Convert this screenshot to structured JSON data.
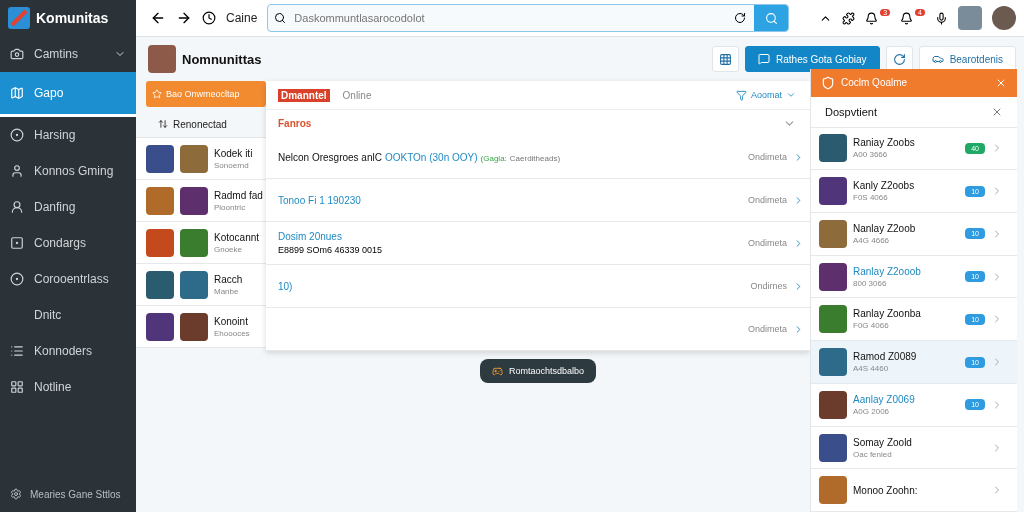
{
  "brand": {
    "name": "Komunitas"
  },
  "sidebar": {
    "items": [
      {
        "label": "Camtins",
        "expanded": false,
        "selected": false
      },
      {
        "label": "Gapo",
        "selected": true
      },
      {
        "label": "Harsing",
        "selected": false
      },
      {
        "label": "Konnos Gming",
        "selected": false
      },
      {
        "label": "Danfing",
        "selected": false
      },
      {
        "label": "Condargs",
        "selected": false
      },
      {
        "label": "Corooentrlass",
        "selected": false
      },
      {
        "label": "Dnitc",
        "selected": false
      },
      {
        "label": "Konnoders",
        "selected": false
      },
      {
        "label": "Notline",
        "selected": false
      }
    ],
    "footer": "Mearies Gane Sttlos"
  },
  "topbar": {
    "title": "Caine",
    "search": {
      "placeholder": "Daskommuntlasarocodolot"
    },
    "badges": [
      "3",
      "4"
    ]
  },
  "header": {
    "title": "Nomnunittas",
    "primary_button": "Rathes Gota Gobiay",
    "secondary_button": "Bearotdenis"
  },
  "list": {
    "action": "Bao Onwmeocltap",
    "sort": "Renonectad",
    "rows": [
      {
        "title": "Kodek iti",
        "subtitle": "Sonoernd"
      },
      {
        "title": "Radmd fad",
        "subtitle": "Ploontric"
      },
      {
        "title": "Kotocannt",
        "subtitle": "Gnoeke"
      },
      {
        "title": "Racch",
        "subtitle": "Manbe"
      },
      {
        "title": "Konoint",
        "subtitle": "Ehoooces"
      }
    ]
  },
  "dropdown": {
    "tabs": [
      {
        "label": "Dmanntel",
        "selected": true
      },
      {
        "label": "Online",
        "selected": false
      }
    ],
    "filter": "Aoomat",
    "section": "Fanros",
    "rows": [
      {
        "parts": [
          {
            "text": "Nelcon Oresgroes anlC",
            "kind": "plain"
          },
          {
            "text": "OOKTOn (30n OOY)",
            "kind": "link"
          },
          {
            "text": "(Gagla:",
            "kind": "tag"
          },
          {
            "text": "Caerditheads)",
            "kind": "note"
          }
        ],
        "detail": "",
        "status": "Ondimeta"
      },
      {
        "parts": [
          {
            "text": "Tonoo Fi 1 190230",
            "kind": "link"
          }
        ],
        "detail": "",
        "status": "Ondimeta"
      },
      {
        "parts": [
          {
            "text": "Dosim 20nues",
            "kind": "link"
          }
        ],
        "detail": "E8899 SOm6 46339 0015",
        "status": "Ondimeta"
      },
      {
        "parts": [
          {
            "text": "10)",
            "kind": "link"
          }
        ],
        "detail": "",
        "status": "Ondirnes"
      },
      {
        "parts": [],
        "detail": "",
        "status": "Ondimeta"
      }
    ]
  },
  "toast": "Romtaochtsdbalbo",
  "panel": {
    "title": "Coclm Qoalme",
    "subtitle": "Dospvtient",
    "items": [
      {
        "name": "Raniay Zoobs",
        "meta": "A00 3666",
        "badge": "40",
        "color": "#1fa866",
        "highlighted": false,
        "selected": false
      },
      {
        "name": "Kanly Z2oobs",
        "meta": "F0S 4066",
        "badge": "10",
        "color": "#2f9be0",
        "highlighted": false,
        "selected": false
      },
      {
        "name": "Nanlay Z2oob",
        "meta": "A4G 4666",
        "badge": "10",
        "color": "#2f9be0",
        "highlighted": false,
        "selected": false
      },
      {
        "name": "Ranlay Z2ooob",
        "meta": "800 3066",
        "badge": "10",
        "color": "#2f9be0",
        "highlighted": true,
        "selected": false
      },
      {
        "name": "Ranlay Zoonba",
        "meta": "F0G 4066",
        "badge": "10",
        "color": "#2f9be0",
        "highlighted": false,
        "selected": false
      },
      {
        "name": "Ramod Z0089",
        "meta": "A4S 4460",
        "badge": "10",
        "color": "#2f9be0",
        "highlighted": false,
        "selected": true
      },
      {
        "name": "Aanlay Z0069",
        "meta": "A0G 2006",
        "badge": "10",
        "color": "#2f9be0",
        "highlighted": true,
        "selected": false
      },
      {
        "name": "Somay Zoold",
        "meta": "Oac fenied",
        "highlighted": false,
        "selected": false
      },
      {
        "name": "Monoo Zoohn:",
        "highlighted": false,
        "selected": false
      }
    ]
  }
}
